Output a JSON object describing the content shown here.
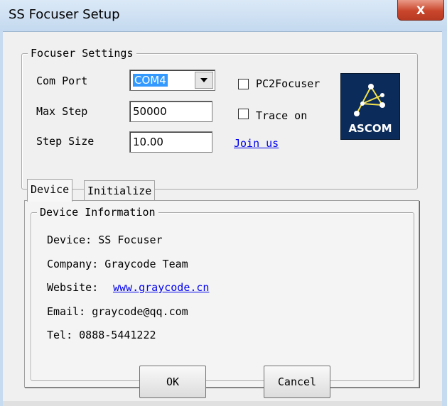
{
  "window": {
    "title": "SS Focuser Setup",
    "close_glyph": "X"
  },
  "focuser_settings": {
    "legend": "Focuser Settings",
    "com_port": {
      "label": "Com Port",
      "value": "COM4"
    },
    "max_step": {
      "label": "Max Step",
      "value": "50000"
    },
    "step_size": {
      "label": "Step Size",
      "value": "10.00"
    },
    "pc2focuser": {
      "label": "PC2Focuser",
      "checked": false
    },
    "trace_on": {
      "label": "Trace on",
      "checked": false
    },
    "join_link": "Join us",
    "logo": {
      "text": "ASCOM",
      "icon": "ascom-logo-icon",
      "color": "#0b2c5a"
    }
  },
  "tabs": [
    {
      "label": "Device",
      "active": true
    },
    {
      "label": "Initialize",
      "active": false
    }
  ],
  "device_info": {
    "legend": "Device Information",
    "device": "Device: SS Focuser",
    "company": "Company: Graycode Team",
    "website_label": "Website:",
    "website_link": "www.graycode.cn",
    "email": "Email: graycode@qq.com",
    "tel": "Tel: 0888-5441222"
  },
  "buttons": {
    "ok": "OK",
    "cancel": "Cancel"
  },
  "colors": {
    "selection": "#3399ff",
    "link": "#0000ee",
    "close_button": "#c9462c"
  }
}
